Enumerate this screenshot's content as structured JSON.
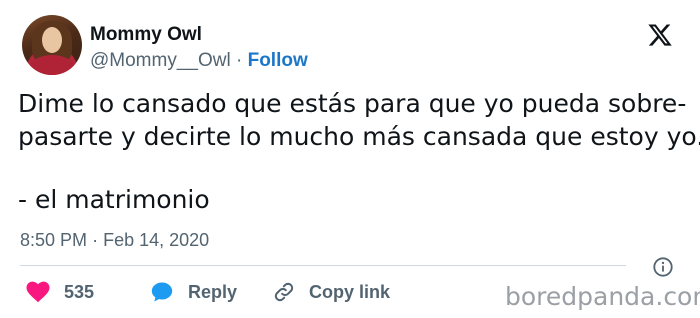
{
  "author": {
    "name": "Mommy Owl",
    "handle": "@Mommy__Owl",
    "separator": "·",
    "follow_label": "Follow"
  },
  "tweet": {
    "lines": [
      "Dime lo cansado que estás para que yo pueda sobre-",
      "pasarte y decirte lo mucho más cansada que estoy yo.",
      "-  el matrimonio"
    ]
  },
  "meta": {
    "time": "8:50 PM",
    "separator": "·",
    "date": "Feb 14, 2020"
  },
  "actions": {
    "like_count": "535",
    "reply_label": "Reply",
    "copy_link_label": "Copy link"
  },
  "watermark": "boredpanda.com",
  "colors": {
    "like": "#f91880",
    "reply": "#1d9bf0",
    "follow": "#1d77c9",
    "muted": "#536471"
  },
  "icons": [
    "x-logo-icon",
    "info-icon",
    "heart-icon",
    "reply-bubble-icon",
    "link-icon"
  ]
}
